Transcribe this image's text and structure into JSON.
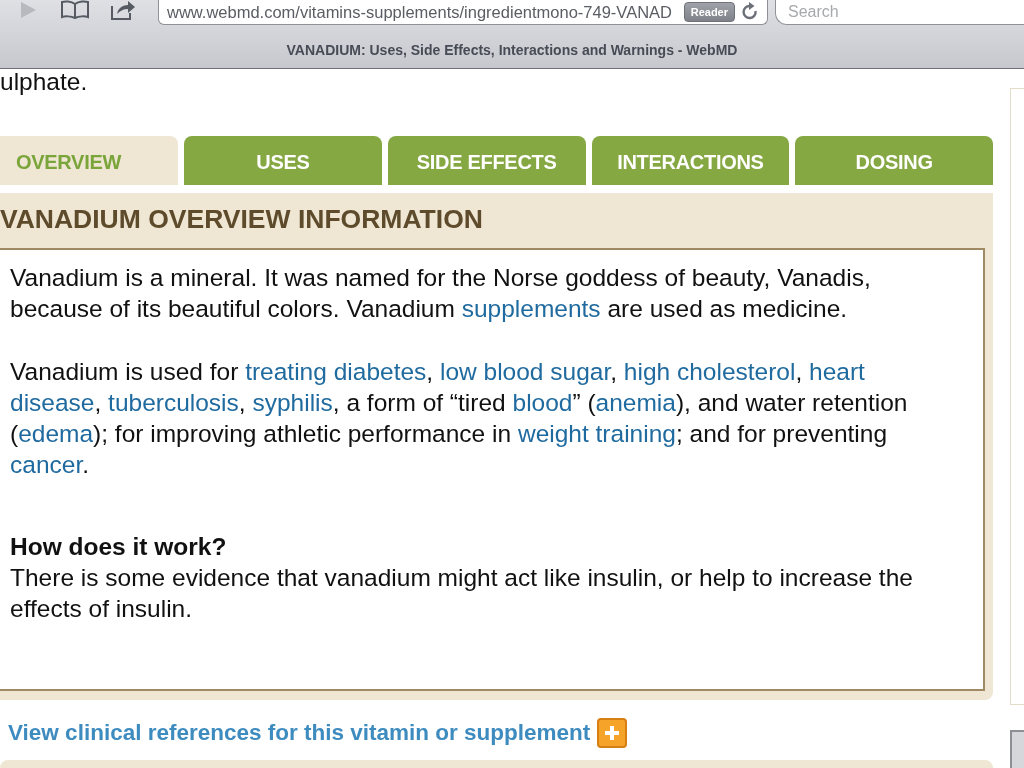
{
  "browser": {
    "forward_button": {
      "disabled": true
    },
    "url": "www.webmd.com/vitamins-supplements/ingredientmono-749-VANAD",
    "reader_button": "Reader",
    "search": {
      "placeholder": "Search"
    },
    "page_title": "VANADIUM: Uses, Side Effects, Interactions and Warnings - WebMD"
  },
  "page": {
    "top_fragment": "ulphate.",
    "tabs": [
      {
        "label": "OVERVIEW",
        "selected": true
      },
      {
        "label": "USES",
        "selected": false
      },
      {
        "label": "SIDE EFFECTS",
        "selected": false
      },
      {
        "label": "INTERACTIONS",
        "selected": false
      },
      {
        "label": "DOSING",
        "selected": false
      }
    ],
    "section_heading": "VANADIUM OVERVIEW INFORMATION",
    "content": [
      {
        "kind": "paragraph",
        "segments": [
          {
            "kind": "text",
            "text": "Vanadium is a mineral. It was named for the Norse goddess of beauty, Vanadis, because of its beautiful colors. Vanadium "
          },
          {
            "kind": "link",
            "text": "supplements"
          },
          {
            "kind": "text",
            "text": " are used as medicine."
          }
        ]
      },
      {
        "kind": "paragraph",
        "segments": [
          {
            "kind": "text",
            "text": "Vanadium is used for "
          },
          {
            "kind": "link",
            "text": "treating diabetes"
          },
          {
            "kind": "text",
            "text": ", "
          },
          {
            "kind": "link",
            "text": "low blood sugar"
          },
          {
            "kind": "text",
            "text": ", "
          },
          {
            "kind": "link",
            "text": "high cholesterol"
          },
          {
            "kind": "text",
            "text": ", "
          },
          {
            "kind": "split_link",
            "lines": [
              "heart",
              "disease"
            ]
          },
          {
            "kind": "text",
            "text": ", "
          },
          {
            "kind": "link",
            "text": "tuberculosis"
          },
          {
            "kind": "text",
            "text": ", "
          },
          {
            "kind": "link",
            "text": "syphilis"
          },
          {
            "kind": "text",
            "text": ", a form of “tired "
          },
          {
            "kind": "link",
            "text": "blood"
          },
          {
            "kind": "text",
            "text": "” ("
          },
          {
            "kind": "link",
            "text": "anemia"
          },
          {
            "kind": "text",
            "text": "), and water retention ("
          },
          {
            "kind": "link",
            "text": "edema"
          },
          {
            "kind": "text",
            "text": "); for improving athletic performance in "
          },
          {
            "kind": "link",
            "text": "weight training"
          },
          {
            "kind": "text",
            "text": "; and for preventing "
          },
          {
            "kind": "link",
            "text": "cancer"
          },
          {
            "kind": "text",
            "text": "."
          }
        ]
      },
      {
        "kind": "subheading",
        "text": "How does it work?"
      },
      {
        "kind": "paragraph",
        "segments": [
          {
            "kind": "text",
            "text": "There is some evidence that vanadium might act like insulin, or help to increase the effects of insulin."
          }
        ]
      }
    ],
    "references_link": "View clinical references for this vitamin or supplement"
  }
}
